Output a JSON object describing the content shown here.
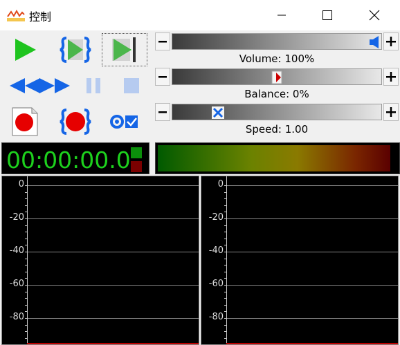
{
  "window": {
    "title": "控制",
    "icon": "wave-app-icon"
  },
  "toolbar": {
    "buttons": [
      {
        "name": "play",
        "icon": "play-icon"
      },
      {
        "name": "play-loop",
        "icon": "play-bracket-icon"
      },
      {
        "name": "play-to-end",
        "icon": "play-to-end-icon"
      },
      {
        "name": "rewind",
        "icon": "rewind-icon"
      },
      {
        "name": "fast-forward",
        "icon": "fast-forward-icon"
      },
      {
        "name": "pause",
        "icon": "pause-icon"
      },
      {
        "name": "stop",
        "icon": "stop-icon"
      },
      {
        "name": "record-new",
        "icon": "record-page-icon"
      },
      {
        "name": "record-loop",
        "icon": "record-bracket-icon"
      },
      {
        "name": "record-options",
        "icon": "record-check-icon"
      }
    ]
  },
  "sliders": {
    "volume": {
      "label": "Volume: 100%",
      "value_percent": 100
    },
    "balance": {
      "label": "Balance: 0%",
      "value_percent": 0
    },
    "speed": {
      "label": "Speed: 1.00",
      "value": 1.0
    }
  },
  "timer": {
    "time": "00:00:00.0"
  },
  "scopes": {
    "ticks": [
      "0",
      "-20",
      "-40",
      "-60",
      "-80"
    ]
  },
  "colors": {
    "play_green": "#1fc41f",
    "blue_accent": "#1565e6",
    "record_red": "#e60000",
    "time_green": "#1dd11d"
  }
}
